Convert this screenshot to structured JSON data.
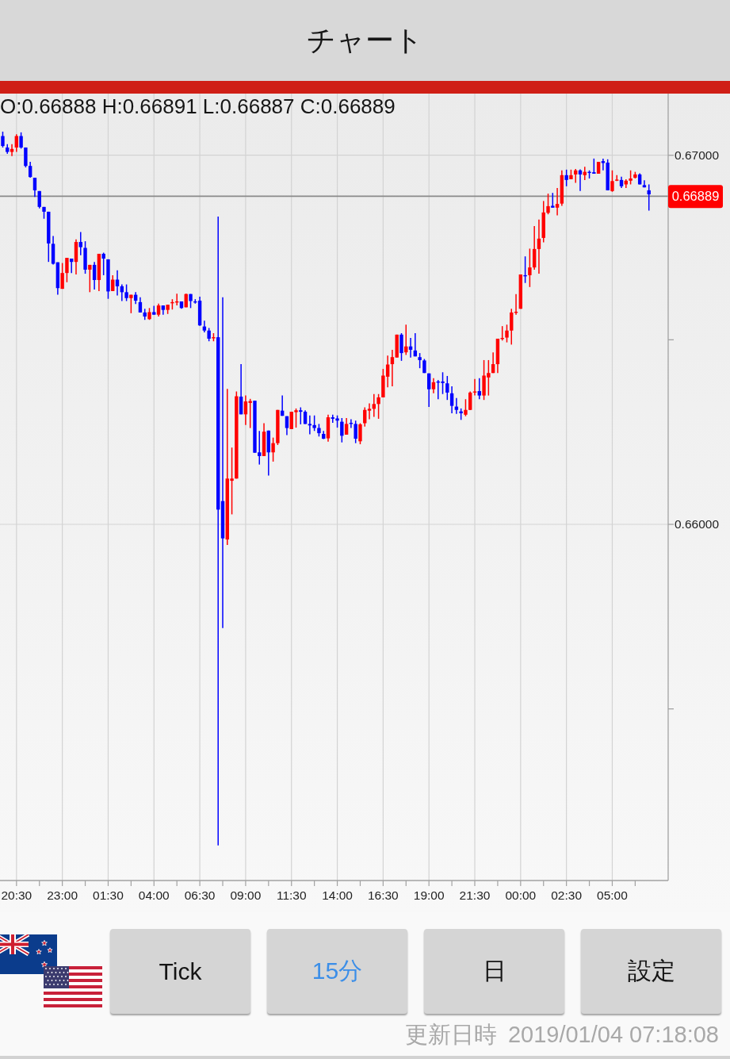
{
  "header": {
    "title": "チャート"
  },
  "chart": {
    "ohlc_readout": "O:0.66888 H:0.66891 L:0.66887 C:0.66889",
    "chart_data": {
      "type": "candlestick",
      "grid": true,
      "x": [
        "2019-01-02T19:45",
        "2019-01-02T20:00",
        "2019-01-02T20:15",
        "2019-01-02T20:30",
        "2019-01-02T20:45",
        "2019-01-02T21:00",
        "2019-01-02T21:15",
        "2019-01-02T21:30",
        "2019-01-02T21:45",
        "2019-01-02T22:00",
        "2019-01-02T22:15",
        "2019-01-02T22:30",
        "2019-01-02T22:45",
        "2019-01-02T23:00",
        "2019-01-02T23:15",
        "2019-01-02T23:30",
        "2019-01-02T23:45",
        "2019-01-03T00:00",
        "2019-01-03T00:15",
        "2019-01-03T00:30",
        "2019-01-03T00:45",
        "2019-01-03T01:00",
        "2019-01-03T01:15",
        "2019-01-03T01:30",
        "2019-01-03T01:45",
        "2019-01-03T02:00",
        "2019-01-03T02:15",
        "2019-01-03T02:30",
        "2019-01-03T02:45",
        "2019-01-03T03:00",
        "2019-01-03T03:15",
        "2019-01-03T03:30",
        "2019-01-03T03:45",
        "2019-01-03T04:00",
        "2019-01-03T04:15",
        "2019-01-03T04:30",
        "2019-01-03T04:45",
        "2019-01-03T05:00",
        "2019-01-03T05:15",
        "2019-01-03T05:30",
        "2019-01-03T05:45",
        "2019-01-03T06:00",
        "2019-01-03T06:15",
        "2019-01-03T06:30",
        "2019-01-03T06:45",
        "2019-01-03T07:00",
        "2019-01-03T07:15",
        "2019-01-03T07:30",
        "2019-01-03T07:45",
        "2019-01-03T08:00",
        "2019-01-03T08:15",
        "2019-01-03T08:30",
        "2019-01-03T08:45",
        "2019-01-03T09:00",
        "2019-01-03T09:15",
        "2019-01-03T09:30",
        "2019-01-03T09:45",
        "2019-01-03T10:00",
        "2019-01-03T10:15",
        "2019-01-03T10:30",
        "2019-01-03T10:45",
        "2019-01-03T11:00",
        "2019-01-03T11:15",
        "2019-01-03T11:30",
        "2019-01-03T11:45",
        "2019-01-03T12:00",
        "2019-01-03T12:15",
        "2019-01-03T12:30",
        "2019-01-03T12:45",
        "2019-01-03T13:00",
        "2019-01-03T13:15",
        "2019-01-03T13:30",
        "2019-01-03T13:45",
        "2019-01-03T14:00",
        "2019-01-03T14:15",
        "2019-01-03T14:30",
        "2019-01-03T14:45",
        "2019-01-03T15:00",
        "2019-01-03T15:15",
        "2019-01-03T15:30",
        "2019-01-03T15:45",
        "2019-01-03T16:00",
        "2019-01-03T16:15",
        "2019-01-03T16:30",
        "2019-01-03T16:45",
        "2019-01-03T17:00",
        "2019-01-03T17:15",
        "2019-01-03T17:30",
        "2019-01-03T17:45",
        "2019-01-03T18:00",
        "2019-01-03T18:15",
        "2019-01-03T18:30",
        "2019-01-03T18:45",
        "2019-01-03T19:00",
        "2019-01-03T19:15",
        "2019-01-03T19:30",
        "2019-01-03T19:45",
        "2019-01-03T20:00",
        "2019-01-03T20:15",
        "2019-01-03T20:30",
        "2019-01-03T20:45",
        "2019-01-03T21:00",
        "2019-01-03T21:15",
        "2019-01-03T21:30",
        "2019-01-03T21:45",
        "2019-01-03T22:00",
        "2019-01-03T22:15",
        "2019-01-03T22:30",
        "2019-01-03T22:45",
        "2019-01-03T23:00",
        "2019-01-03T23:15",
        "2019-01-03T23:30",
        "2019-01-03T23:45",
        "2019-01-04T00:00",
        "2019-01-04T00:15",
        "2019-01-04T00:30",
        "2019-01-04T00:45",
        "2019-01-04T01:00",
        "2019-01-04T01:15",
        "2019-01-04T01:30",
        "2019-01-04T01:45",
        "2019-01-04T02:00",
        "2019-01-04T02:15",
        "2019-01-04T02:30",
        "2019-01-04T02:45",
        "2019-01-04T03:00",
        "2019-01-04T03:15",
        "2019-01-04T03:30",
        "2019-01-04T03:45",
        "2019-01-04T04:00",
        "2019-01-04T04:15",
        "2019-01-04T04:30",
        "2019-01-04T04:45",
        "2019-01-04T05:00",
        "2019-01-04T05:15",
        "2019-01-04T05:30",
        "2019-01-04T05:45",
        "2019-01-04T06:00",
        "2019-01-04T06:15",
        "2019-01-04T06:30",
        "2019-01-04T06:45",
        "2019-01-04T07:00"
      ],
      "ohlc": [
        [
          0.67052,
          0.67064,
          0.67021,
          0.67025
        ],
        [
          0.67021,
          0.6703,
          0.67004,
          0.67009
        ],
        [
          0.67009,
          0.6703,
          0.66998,
          0.67017
        ],
        [
          0.67021,
          0.67057,
          0.67009,
          0.67052
        ],
        [
          0.67052,
          0.67062,
          0.67018,
          0.67021
        ],
        [
          0.67021,
          0.67021,
          0.66967,
          0.66971
        ],
        [
          0.66971,
          0.66982,
          0.66939,
          0.66941
        ],
        [
          0.66939,
          0.66939,
          0.66887,
          0.66905
        ],
        [
          0.66903,
          0.66903,
          0.66856,
          0.6686
        ],
        [
          0.6686,
          0.6686,
          0.66828,
          0.66847
        ],
        [
          0.66847,
          0.66847,
          0.66711,
          0.66761
        ],
        [
          0.6676,
          0.66781,
          0.66704,
          0.66706
        ],
        [
          0.6671,
          0.6671,
          0.66622,
          0.6664
        ],
        [
          0.66638,
          0.66708,
          0.66638,
          0.66681
        ],
        [
          0.66681,
          0.66722,
          0.66656,
          0.66722
        ],
        [
          0.6672,
          0.6672,
          0.66681,
          0.66711
        ],
        [
          0.66711,
          0.66772,
          0.66677,
          0.66765
        ],
        [
          0.66765,
          0.66792,
          0.66729,
          0.66751
        ],
        [
          0.66749,
          0.66767,
          0.66679,
          0.6669
        ],
        [
          0.6669,
          0.66703,
          0.66629,
          0.66703
        ],
        [
          0.66703,
          0.66711,
          0.66636,
          0.66662
        ],
        [
          0.66662,
          0.66733,
          0.66632,
          0.66733
        ],
        [
          0.66733,
          0.66736,
          0.66675,
          0.6672
        ],
        [
          0.66718,
          0.66718,
          0.66611,
          0.66631
        ],
        [
          0.66632,
          0.66675,
          0.66632,
          0.66663
        ],
        [
          0.66663,
          0.66688,
          0.6662,
          0.66645
        ],
        [
          0.66645,
          0.6665,
          0.66605,
          0.66629
        ],
        [
          0.66629,
          0.6665,
          0.66605,
          0.66613
        ],
        [
          0.66613,
          0.66622,
          0.66572,
          0.66622
        ],
        [
          0.66622,
          0.66629,
          0.66597,
          0.66606
        ],
        [
          0.66602,
          0.66615,
          0.66574,
          0.66574
        ],
        [
          0.66574,
          0.66584,
          0.66554,
          0.66563
        ],
        [
          0.66556,
          0.66586,
          0.66554,
          0.66575
        ],
        [
          0.66575,
          0.66592,
          0.66568,
          0.66568
        ],
        [
          0.66568,
          0.66598,
          0.66563,
          0.66593
        ],
        [
          0.66593,
          0.66593,
          0.66568,
          0.66581
        ],
        [
          0.66581,
          0.66595,
          0.6657,
          0.66595
        ],
        [
          0.66599,
          0.6661,
          0.66582,
          0.66602
        ],
        [
          0.66603,
          0.66625,
          0.66593,
          0.66604
        ],
        [
          0.66604,
          0.66604,
          0.66584,
          0.66586
        ],
        [
          0.66588,
          0.66625,
          0.66588,
          0.66624
        ],
        [
          0.66624,
          0.66624,
          0.66586,
          0.66605
        ],
        [
          0.66604,
          0.6661,
          0.66598,
          0.66602
        ],
        [
          0.66606,
          0.66617,
          0.66538,
          0.66539
        ],
        [
          0.66536,
          0.66552,
          0.6652,
          0.66525
        ],
        [
          0.66525,
          0.66532,
          0.66496,
          0.66503
        ],
        [
          0.66506,
          0.66518,
          0.66496,
          0.66507
        ],
        [
          0.66507,
          0.66834,
          0.6513,
          0.6604
        ],
        [
          0.66063,
          0.66615,
          0.65719,
          0.65962
        ],
        [
          0.65959,
          0.66367,
          0.65944,
          0.66124
        ],
        [
          0.66118,
          0.66208,
          0.66027,
          0.66124
        ],
        [
          0.66124,
          0.6636,
          0.66124,
          0.66347
        ],
        [
          0.66346,
          0.66434,
          0.66298,
          0.66298
        ],
        [
          0.66298,
          0.66349,
          0.66269,
          0.66333
        ],
        [
          0.66329,
          0.6634,
          0.66261,
          0.66334
        ],
        [
          0.66335,
          0.66335,
          0.66194,
          0.66194
        ],
        [
          0.66195,
          0.66253,
          0.66162,
          0.66185
        ],
        [
          0.66185,
          0.66274,
          0.66185,
          0.66251
        ],
        [
          0.66254,
          0.66254,
          0.66132,
          0.66195
        ],
        [
          0.66195,
          0.66235,
          0.6617,
          0.6622
        ],
        [
          0.6622,
          0.6631,
          0.66215,
          0.6631
        ],
        [
          0.66308,
          0.66349,
          0.66294,
          0.66294
        ],
        [
          0.66293,
          0.66293,
          0.66242,
          0.66261
        ],
        [
          0.66258,
          0.66305,
          0.66258,
          0.66305
        ],
        [
          0.66304,
          0.66314,
          0.66262,
          0.66309
        ],
        [
          0.66309,
          0.66317,
          0.66271,
          0.66305
        ],
        [
          0.66305,
          0.66309,
          0.66272,
          0.66272
        ],
        [
          0.66272,
          0.66295,
          0.66244,
          0.66268
        ],
        [
          0.66269,
          0.66295,
          0.66253,
          0.66261
        ],
        [
          0.66261,
          0.66272,
          0.66238,
          0.66247
        ],
        [
          0.66245,
          0.66253,
          0.66231,
          0.66232
        ],
        [
          0.66233,
          0.66297,
          0.66224,
          0.6629
        ],
        [
          0.6629,
          0.66297,
          0.66275,
          0.66286
        ],
        [
          0.66287,
          0.66295,
          0.66262,
          0.66281
        ],
        [
          0.66278,
          0.66288,
          0.66222,
          0.6624
        ],
        [
          0.66243,
          0.66288,
          0.66243,
          0.66272
        ],
        [
          0.66275,
          0.66285,
          0.66261,
          0.66272
        ],
        [
          0.66272,
          0.66281,
          0.6622,
          0.66232
        ],
        [
          0.66225,
          0.66274,
          0.66217,
          0.66271
        ],
        [
          0.66274,
          0.66317,
          0.66265,
          0.6631
        ],
        [
          0.66308,
          0.66328,
          0.66285,
          0.66313
        ],
        [
          0.66313,
          0.66353,
          0.66291,
          0.66326
        ],
        [
          0.66326,
          0.66353,
          0.66286,
          0.66344
        ],
        [
          0.66344,
          0.66421,
          0.66344,
          0.66403
        ],
        [
          0.664,
          0.66457,
          0.66371,
          0.66433
        ],
        [
          0.66434,
          0.66473,
          0.66374,
          0.66453
        ],
        [
          0.66452,
          0.66514,
          0.66452,
          0.66514
        ],
        [
          0.66514,
          0.66518,
          0.66443,
          0.66464
        ],
        [
          0.66466,
          0.66541,
          0.66459,
          0.66482
        ],
        [
          0.66482,
          0.66505,
          0.66452,
          0.66473
        ],
        [
          0.66471,
          0.66518,
          0.66455,
          0.66455
        ],
        [
          0.66453,
          0.66464,
          0.66423,
          0.66445
        ],
        [
          0.66444,
          0.66448,
          0.6641,
          0.6641
        ],
        [
          0.66409,
          0.66409,
          0.66318,
          0.66366
        ],
        [
          0.66366,
          0.66396,
          0.66355,
          0.66385
        ],
        [
          0.66387,
          0.66391,
          0.66339,
          0.66385
        ],
        [
          0.66387,
          0.66412,
          0.66353,
          0.66383
        ],
        [
          0.66382,
          0.66402,
          0.66337,
          0.66357
        ],
        [
          0.66355,
          0.66374,
          0.66301,
          0.66321
        ],
        [
          0.66319,
          0.66342,
          0.66299,
          0.6631
        ],
        [
          0.66306,
          0.66314,
          0.66283,
          0.66301
        ],
        [
          0.66297,
          0.66339,
          0.66293,
          0.6631
        ],
        [
          0.6631,
          0.6636,
          0.6631,
          0.66357
        ],
        [
          0.66357,
          0.66394,
          0.66349,
          0.6636
        ],
        [
          0.66361,
          0.66396,
          0.66339,
          0.66349
        ],
        [
          0.66349,
          0.66445,
          0.66337,
          0.66403
        ],
        [
          0.66398,
          0.66445,
          0.66349,
          0.6641
        ],
        [
          0.6641,
          0.66466,
          0.6641,
          0.66434
        ],
        [
          0.66434,
          0.66503,
          0.6641,
          0.66503
        ],
        [
          0.66504,
          0.66537,
          0.66498,
          0.66505
        ],
        [
          0.66506,
          0.66541,
          0.66493,
          0.66525
        ],
        [
          0.66525,
          0.66584,
          0.66487,
          0.66574
        ],
        [
          0.66575,
          0.66624,
          0.66568,
          0.66576
        ],
        [
          0.66584,
          0.66677,
          0.66584,
          0.66677
        ],
        [
          0.66675,
          0.66726,
          0.66654,
          0.66674
        ],
        [
          0.66675,
          0.66747,
          0.66643,
          0.66696
        ],
        [
          0.66696,
          0.66808,
          0.6669,
          0.66746
        ],
        [
          0.66746,
          0.66826,
          0.66679,
          0.66774
        ],
        [
          0.66776,
          0.66876,
          0.66764,
          0.66845
        ],
        [
          0.66844,
          0.66896,
          0.6684,
          0.66862
        ],
        [
          0.66863,
          0.66898,
          0.66858,
          0.66858
        ],
        [
          0.66858,
          0.66911,
          0.66837,
          0.66868
        ],
        [
          0.66869,
          0.66959,
          0.66863,
          0.66946
        ],
        [
          0.66946,
          0.66961,
          0.66916,
          0.66933
        ],
        [
          0.66935,
          0.66961,
          0.66935,
          0.66946
        ],
        [
          0.66948,
          0.66963,
          0.66925,
          0.66959
        ],
        [
          0.66959,
          0.66962,
          0.66903,
          0.66948
        ],
        [
          0.66946,
          0.66969,
          0.66933,
          0.66955
        ],
        [
          0.66955,
          0.66959,
          0.66937,
          0.66953
        ],
        [
          0.66954,
          0.66991,
          0.6695,
          0.6695
        ],
        [
          0.6695,
          0.66982,
          0.6695,
          0.66982
        ],
        [
          0.66984,
          0.66991,
          0.66959,
          0.66979
        ],
        [
          0.6698,
          0.66989,
          0.66905,
          0.66905
        ],
        [
          0.66903,
          0.66959,
          0.66901,
          0.6693
        ],
        [
          0.66933,
          0.66946,
          0.6693,
          0.66934
        ],
        [
          0.66933,
          0.66942,
          0.66911,
          0.66916
        ],
        [
          0.66921,
          0.66935,
          0.66911,
          0.66931
        ],
        [
          0.66931,
          0.66959,
          0.66921,
          0.66937
        ],
        [
          0.66939,
          0.66955,
          0.66937,
          0.66948
        ],
        [
          0.66948,
          0.66951,
          0.66921,
          0.66921
        ],
        [
          0.66919,
          0.66932,
          0.66913,
          0.66913
        ],
        [
          0.66905,
          0.66921,
          0.6685,
          0.66894
        ]
      ],
      "xlim": [
        "2019-01-02T19:36",
        "2019-01-04T08:03"
      ],
      "ylim": [
        0.65035,
        0.67167
      ],
      "xticks": [
        {
          "value": "2019-01-02T20:30",
          "label": "20:30"
        },
        {
          "value": "2019-01-02T23:00",
          "label": "23:00"
        },
        {
          "value": "2019-01-03T01:30",
          "label": "01:30"
        },
        {
          "value": "2019-01-03T04:00",
          "label": "04:00"
        },
        {
          "value": "2019-01-03T06:30",
          "label": "06:30"
        },
        {
          "value": "2019-01-03T09:00",
          "label": "09:00"
        },
        {
          "value": "2019-01-03T11:30",
          "label": "11:30"
        },
        {
          "value": "2019-01-03T14:00",
          "label": "14:00"
        },
        {
          "value": "2019-01-03T16:30",
          "label": "16:30"
        },
        {
          "value": "2019-01-03T19:00",
          "label": "19:00"
        },
        {
          "value": "2019-01-03T21:30",
          "label": "21:30"
        },
        {
          "value": "2019-01-04T00:00",
          "label": "00:00"
        },
        {
          "value": "2019-01-04T02:30",
          "label": "02:30"
        },
        {
          "value": "2019-01-04T05:00",
          "label": "05:00"
        }
      ],
      "yticks": [
        {
          "value": 0.67,
          "label": "0.67000"
        },
        {
          "value": 0.66,
          "label": "0.66000"
        }
      ],
      "ref_lines": [
        {
          "axis": "y",
          "value": 0.66889,
          "label": "0.66889"
        }
      ]
    }
  },
  "timeframes": [
    {
      "label": "Tick",
      "selected": false
    },
    {
      "label": "15分",
      "selected": true
    },
    {
      "label": "日",
      "selected": false
    }
  ],
  "settings_button": {
    "label": "設定"
  },
  "updated": {
    "label": "更新日時",
    "value": "2019/01/04 07:18:08"
  }
}
